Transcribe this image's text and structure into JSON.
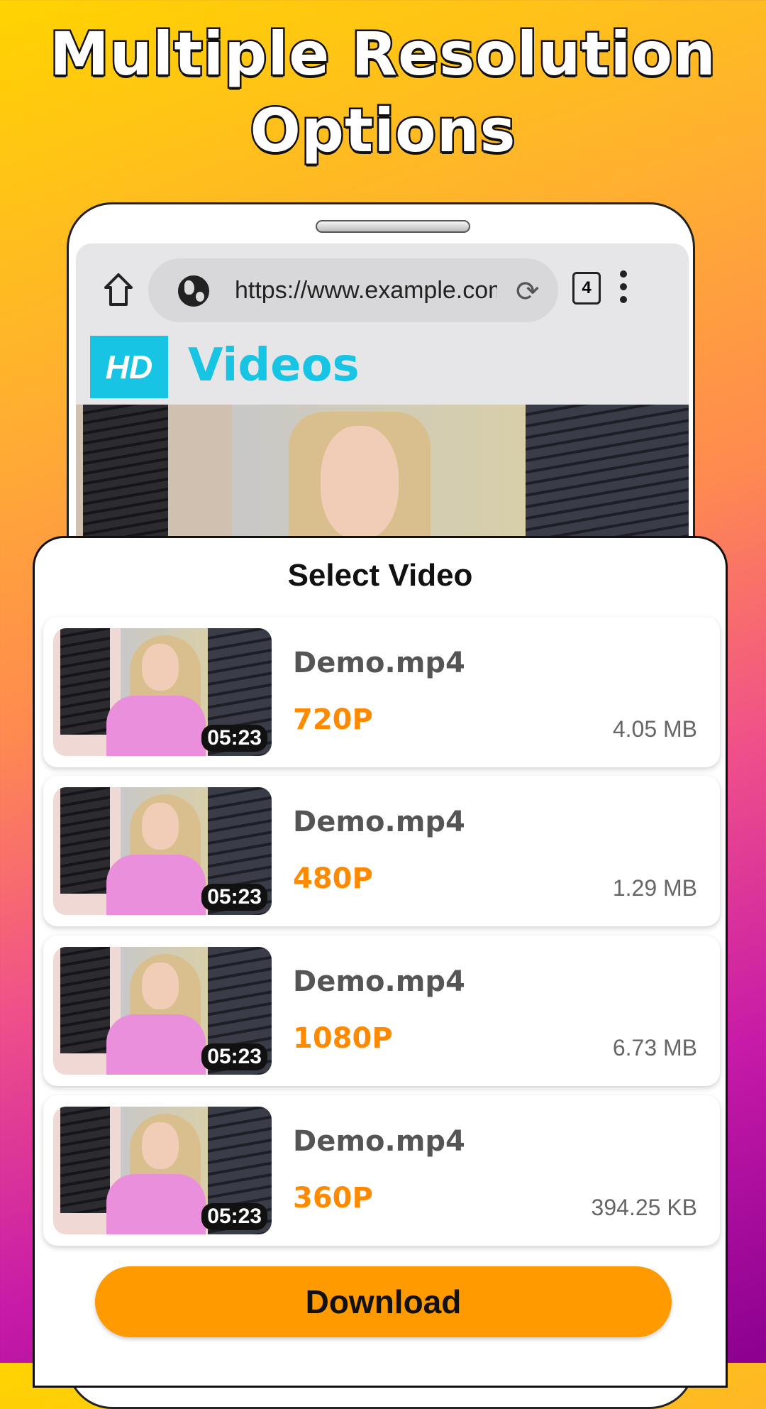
{
  "headline": {
    "line1": "Multiple Resolution",
    "line2": "Options"
  },
  "browser": {
    "url": "https://www.example.com",
    "tab_count": "4",
    "icons": [
      "home-icon",
      "globe-icon",
      "reload-icon",
      "tabs-icon",
      "more-vert-icon"
    ]
  },
  "site": {
    "logo_badge": "HD",
    "logo_text": "Videos",
    "accent": "#17c4e4"
  },
  "sheet": {
    "title": "Select Video",
    "items": [
      {
        "name": "Demo.mp4",
        "resolution": "720P",
        "size": "4.05 MB",
        "duration": "05:23"
      },
      {
        "name": "Demo.mp4",
        "resolution": "480P",
        "size": "1.29 MB",
        "duration": "05:23"
      },
      {
        "name": "Demo.mp4",
        "resolution": "1080P",
        "size": "6.73 MB",
        "duration": "05:23"
      },
      {
        "name": "Demo.mp4",
        "resolution": "360P",
        "size": "394.25 KB",
        "duration": "05:23"
      }
    ],
    "download_label": "Download",
    "resolution_color": "#ff8a00",
    "button_color": "#ff9a00"
  }
}
